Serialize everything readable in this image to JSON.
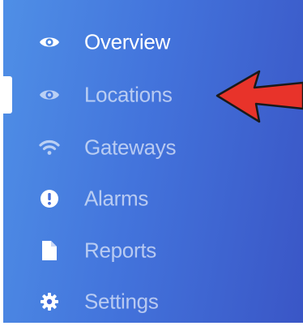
{
  "sidebar": {
    "items": [
      {
        "label": "Overview",
        "icon": "eye-icon",
        "state": "active"
      },
      {
        "label": "Locations",
        "icon": "eye-icon",
        "state": "selected"
      },
      {
        "label": "Gateways",
        "icon": "wifi-icon",
        "state": "inactive"
      },
      {
        "label": "Alarms",
        "icon": "exclamation-circle-icon",
        "state": "inactive"
      },
      {
        "label": "Reports",
        "icon": "file-icon",
        "state": "inactive"
      },
      {
        "label": "Settings",
        "icon": "gear-icon",
        "state": "inactive"
      }
    ]
  },
  "annotation": {
    "arrow_color": "#e8332a"
  },
  "colors": {
    "sidebar_gradient_start": "#4f8fe6",
    "sidebar_gradient_end": "#3a56c6",
    "active_text": "#ffffff"
  }
}
